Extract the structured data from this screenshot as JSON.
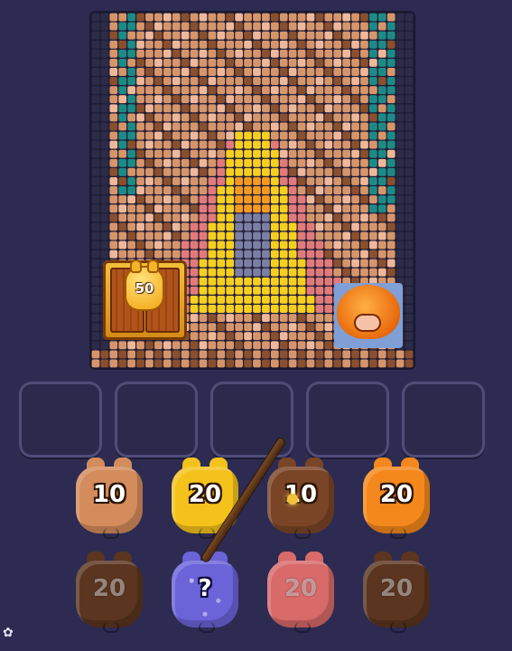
{
  "board": {
    "mosaic_colors": {
      "teal": "#1c8b86",
      "brown_light": "#d7956a",
      "brown_dark": "#8a4f2c",
      "pink": "#e27a7a",
      "yellow": "#f7cf1f",
      "orange": "#f59a1c",
      "gray_blue": "#7b7fa3",
      "dark": "#2c2b48",
      "peach": "#f0b898"
    },
    "chest_value": "50",
    "pig_piece_icon": "pumpkin-pig-icon"
  },
  "slots": [
    {
      "state": "empty"
    },
    {
      "state": "empty"
    },
    {
      "state": "empty"
    },
    {
      "state": "empty"
    },
    {
      "state": "empty"
    }
  ],
  "pigs_row1": [
    {
      "value": "10",
      "color": "#d48c5c"
    },
    {
      "value": "20",
      "color": "#f4c21b"
    },
    {
      "value": "10",
      "color": "#7a4526"
    },
    {
      "value": "20",
      "color": "#f5881c"
    }
  ],
  "pigs_row2": [
    {
      "value": "20",
      "color": "#5b3520"
    },
    {
      "value": "?",
      "color": "#6b63d8"
    },
    {
      "value": "20",
      "color": "#d86a6a"
    },
    {
      "value": "20",
      "color": "#5b3520"
    }
  ],
  "tool_icon": "wand-icon",
  "settings_icon": "gear-icon"
}
